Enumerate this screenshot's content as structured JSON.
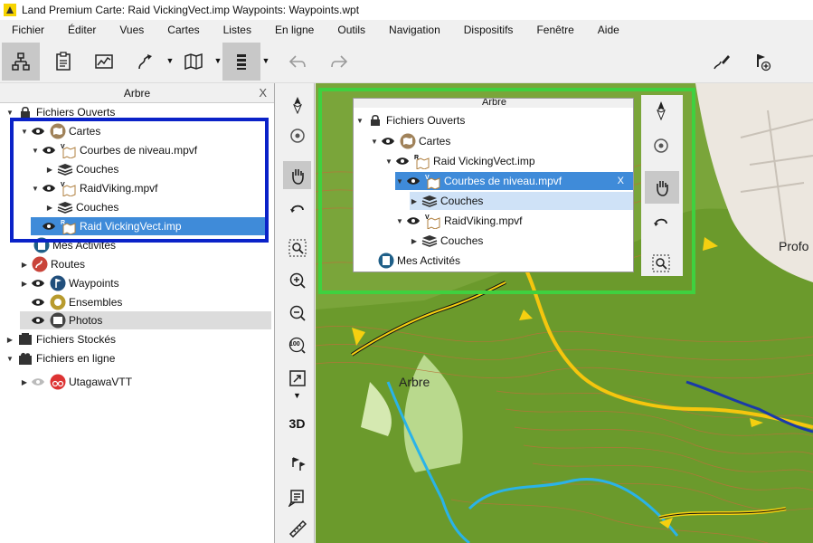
{
  "window": {
    "title": "Land Premium Carte: Raid VickingVect.imp Waypoints:  Waypoints.wpt"
  },
  "menu": [
    "Fichier",
    "Éditer",
    "Vues",
    "Cartes",
    "Listes",
    "En ligne",
    "Outils",
    "Navigation",
    "Dispositifs",
    "Fenêtre",
    "Aide"
  ],
  "toolbar": {
    "buttons": [
      "tree-view",
      "list-view",
      "chart-view",
      "route-tool",
      "map-tool",
      "layers-tool",
      "undo",
      "redo",
      "edit-route",
      "add-waypoint"
    ],
    "undo_icon": "undo-icon",
    "redo_icon": "redo-icon"
  },
  "panel": {
    "title": "Arbre",
    "close": "X",
    "tree": [
      {
        "label": "Fichiers Ouverts",
        "icon": "lock-icon"
      },
      {
        "label": "Cartes",
        "icon": "map-folder-icon"
      },
      {
        "label": "Courbes de niveau.mpvf",
        "icon": "vector-map-icon"
      },
      {
        "label": "Couches",
        "icon": "layers-icon"
      },
      {
        "label": "RaidViking.mpvf",
        "icon": "vector-map-icon"
      },
      {
        "label": "Couches",
        "icon": "layers-icon"
      },
      {
        "label": "Raid VickingVect.imp",
        "icon": "raster-map-icon",
        "selected": true
      },
      {
        "label": "Mes Activités",
        "icon": "activity-icon"
      },
      {
        "label": "Routes",
        "icon": "route-icon"
      },
      {
        "label": "Waypoints",
        "icon": "waypoint-icon"
      },
      {
        "label": "Ensembles",
        "icon": "set-icon"
      },
      {
        "label": "Photos",
        "icon": "photo-icon"
      },
      {
        "label": "Fichiers Stockés",
        "icon": "storage-icon"
      },
      {
        "label": "Fichiers en ligne",
        "icon": "cloud-folder-icon"
      },
      {
        "label": "UtagawaVTT",
        "icon": "utagawa-icon"
      }
    ]
  },
  "inset": {
    "title": "Arbre",
    "close": "X",
    "tree": [
      {
        "label": "Fichiers Ouverts"
      },
      {
        "label": "Cartes"
      },
      {
        "label": "Raid VickingVect.imp"
      },
      {
        "label": "Courbes de niveau.mpvf",
        "selected": true
      },
      {
        "label": "Couches"
      },
      {
        "label": "RaidViking.mpvf"
      },
      {
        "label": "Couches"
      },
      {
        "label": "Mes Activités"
      }
    ]
  },
  "map": {
    "labels": [
      "Arbre",
      "Profo"
    ]
  },
  "sidebar": {
    "zoom_label": "100",
    "view_3d": "3D"
  },
  "colors": {
    "selection_blue": "#3f8bd9",
    "annotation_blue": "#0a22c8",
    "annotation_green": "#3fd13f",
    "map_green": "#6d9a2d"
  }
}
